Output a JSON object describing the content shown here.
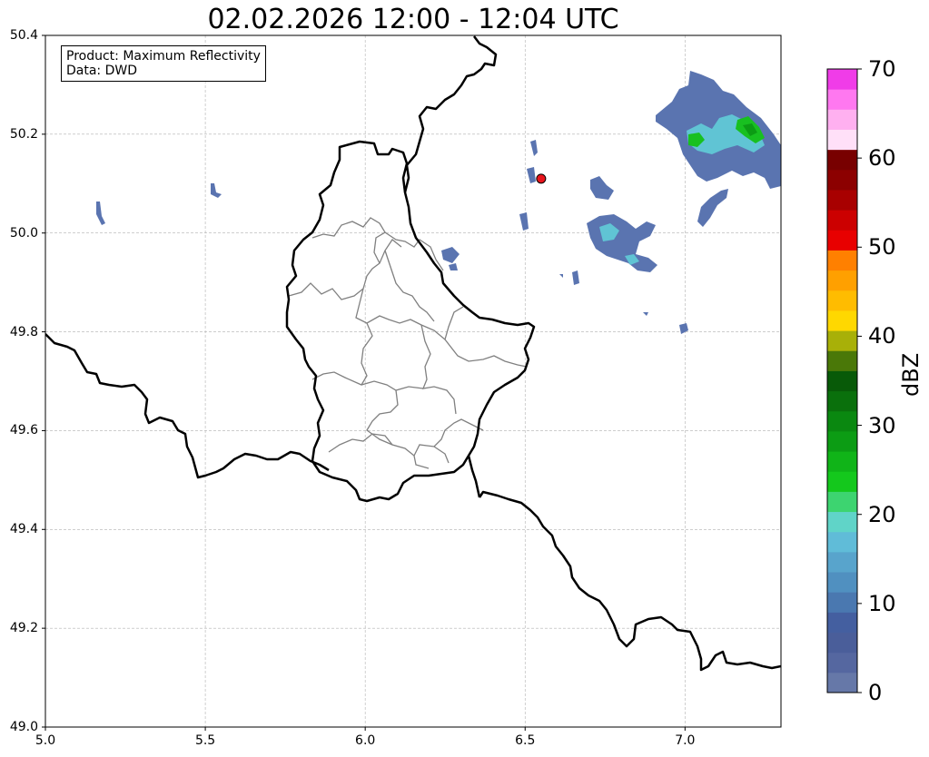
{
  "title": "02.02.2026 12:00 - 12:04 UTC",
  "info": {
    "product": "Product: Maximum Reflectivity",
    "data": "Data: DWD"
  },
  "map": {
    "lon_range": [
      5.0,
      7.3
    ],
    "lat_range": [
      49.0,
      50.4
    ],
    "x_ticks": [
      "5.0",
      "5.5",
      "6.0",
      "6.5",
      "7.0"
    ],
    "y_ticks": [
      "49.0",
      "49.2",
      "49.4",
      "49.6",
      "49.8",
      "50.0",
      "50.2",
      "50.4"
    ],
    "grid": true,
    "marker": {
      "lon": 6.55,
      "lat": 50.11,
      "color": "#e8141c"
    }
  },
  "colorbar": {
    "label": "dBZ",
    "ticks": [
      "0",
      "10",
      "20",
      "30",
      "40",
      "50",
      "60",
      "70"
    ],
    "min": 0,
    "max": 70,
    "colors": [
      "#6678a8",
      "#5567a0",
      "#4a5e9a",
      "#445fa0",
      "#4a78b0",
      "#5090c0",
      "#58a4cc",
      "#60bcd8",
      "#60d4c8",
      "#3dd470",
      "#14c81c",
      "#10b418",
      "#0c9c14",
      "#0a8810",
      "#0a700c",
      "#085a08",
      "#4a7808",
      "#a8b008",
      "#ffd800",
      "#ffbc00",
      "#ffa000",
      "#ff8000",
      "#e80000",
      "#cc0000",
      "#a80000",
      "#8c0000",
      "#780000",
      "#ffe0f8",
      "#ffb0f0",
      "#ff78f0",
      "#f03ce8"
    ]
  }
}
